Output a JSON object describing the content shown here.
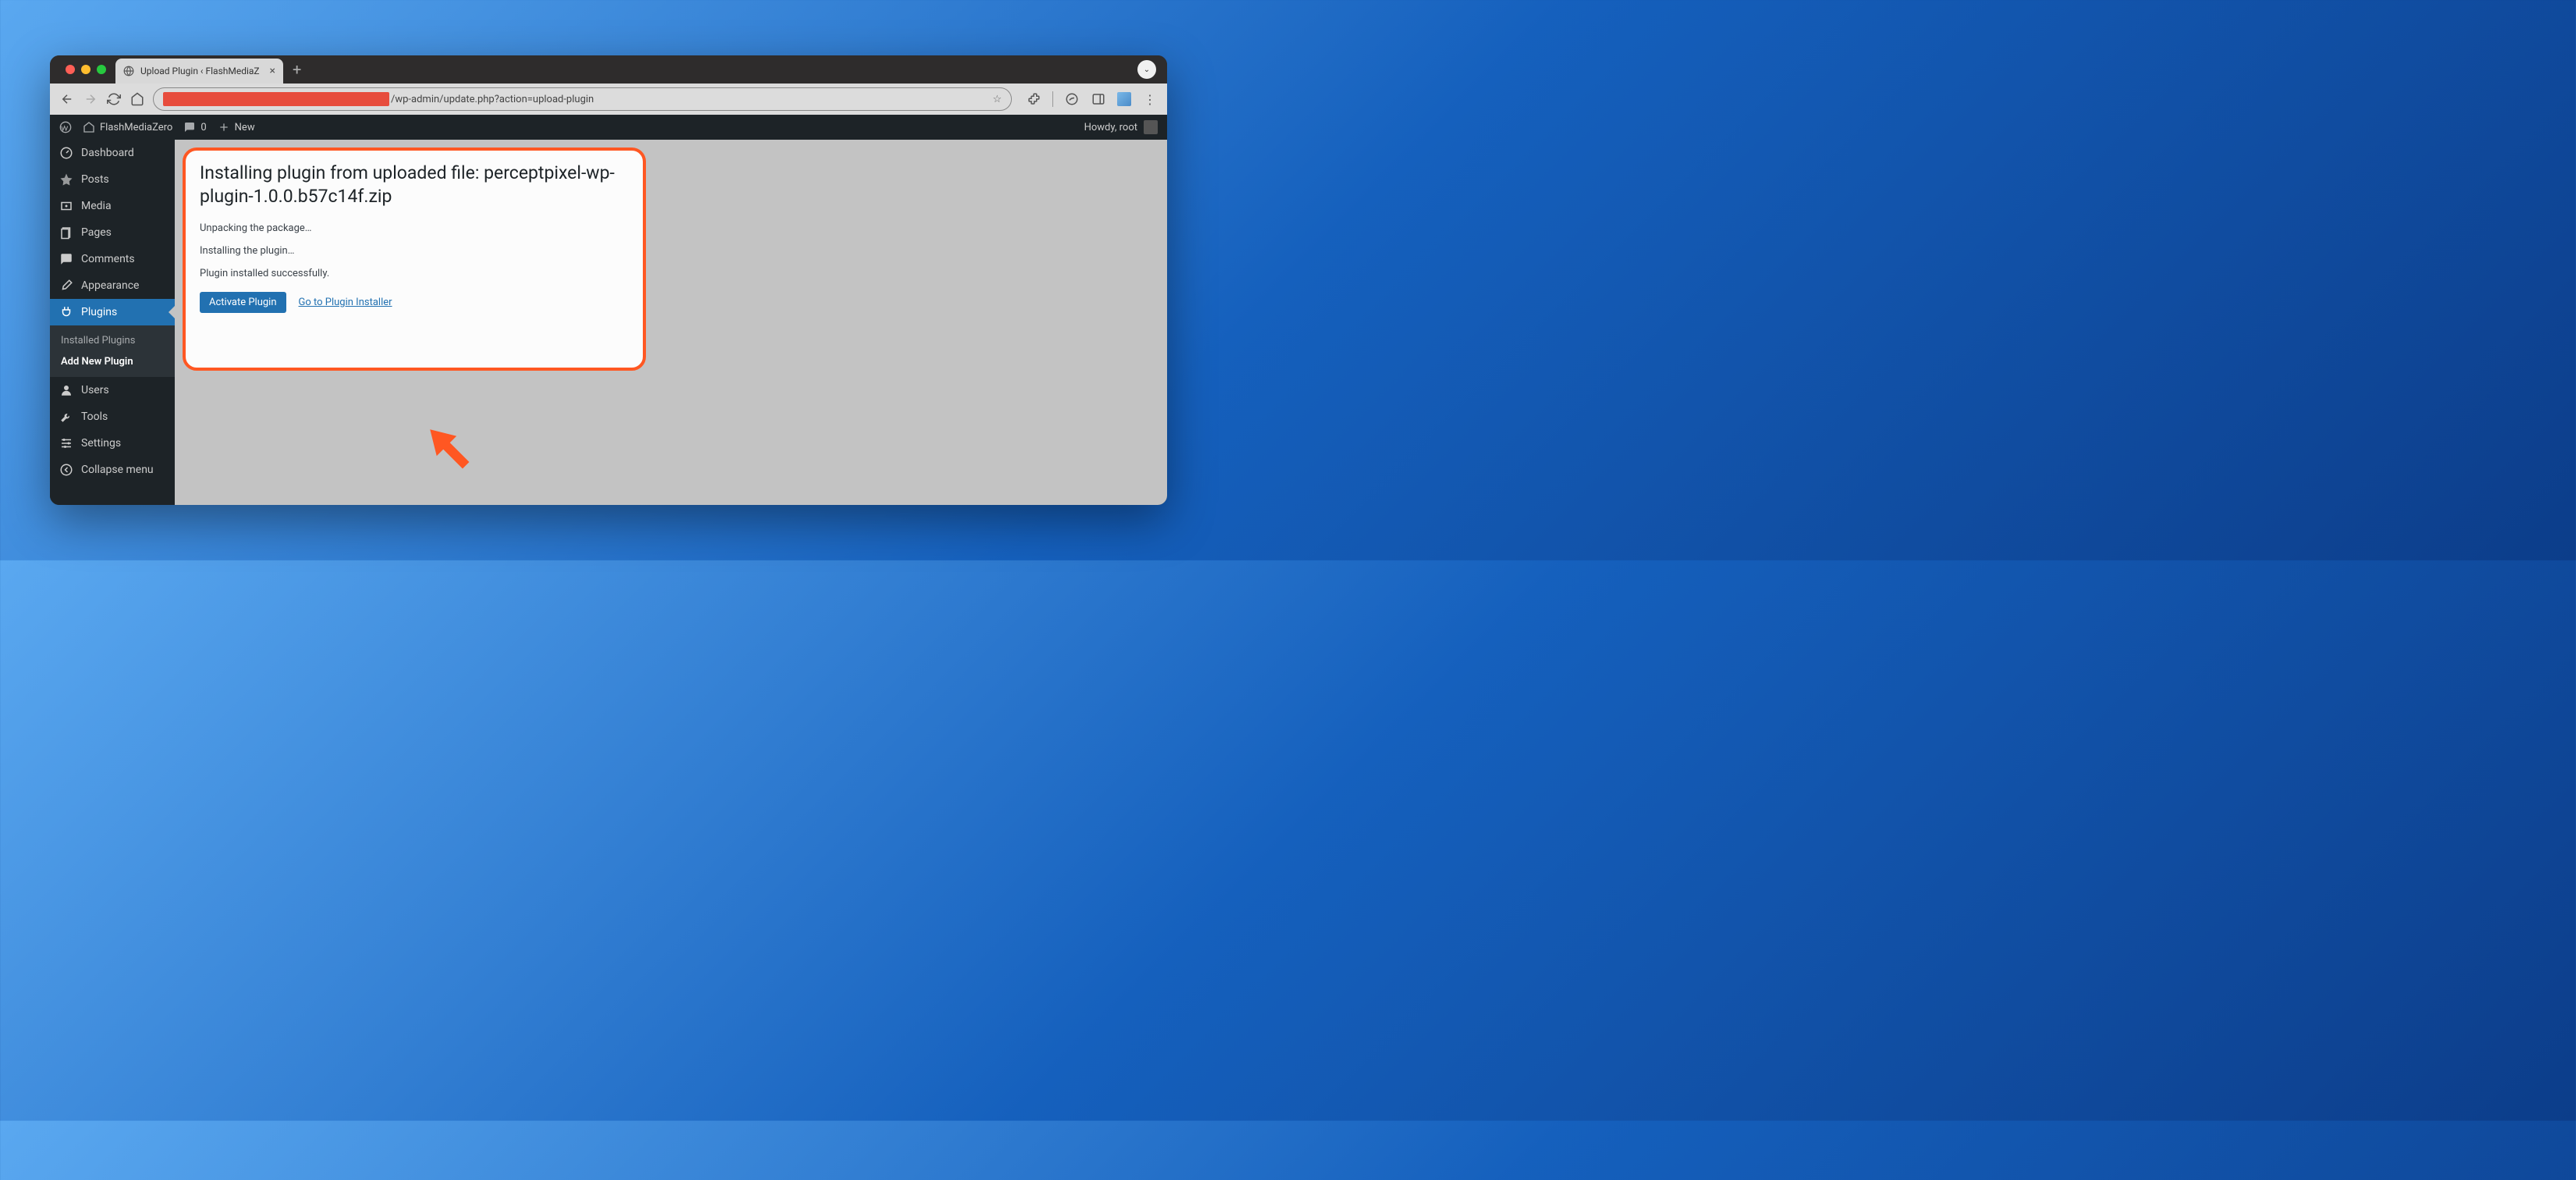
{
  "browser": {
    "tab_title": "Upload Plugin ‹ FlashMediaZ",
    "url_visible": "/wp-admin/update.php?action=upload-plugin"
  },
  "adminbar": {
    "site_name": "FlashMediaZero",
    "comments_count": "0",
    "new_label": "New",
    "howdy": "Howdy, root"
  },
  "sidebar": {
    "items": [
      {
        "label": "Dashboard"
      },
      {
        "label": "Posts"
      },
      {
        "label": "Media"
      },
      {
        "label": "Pages"
      },
      {
        "label": "Comments"
      },
      {
        "label": "Appearance"
      },
      {
        "label": "Plugins"
      },
      {
        "label": "Users"
      },
      {
        "label": "Tools"
      },
      {
        "label": "Settings"
      },
      {
        "label": "Collapse menu"
      }
    ],
    "sub_plugins": [
      {
        "label": "Installed Plugins"
      },
      {
        "label": "Add New Plugin"
      }
    ]
  },
  "page": {
    "heading": "Installing plugin from uploaded file: perceptpixel-wp-plugin-1.0.0.b57c14f.zip",
    "status_unpack": "Unpacking the package…",
    "status_install": "Installing the plugin…",
    "status_success": "Plugin installed successfully.",
    "btn_activate": "Activate Plugin",
    "link_installer": "Go to Plugin Installer"
  },
  "annotation": {
    "highlight_color": "#ff5722",
    "arrow_target": "activate-plugin-button"
  }
}
